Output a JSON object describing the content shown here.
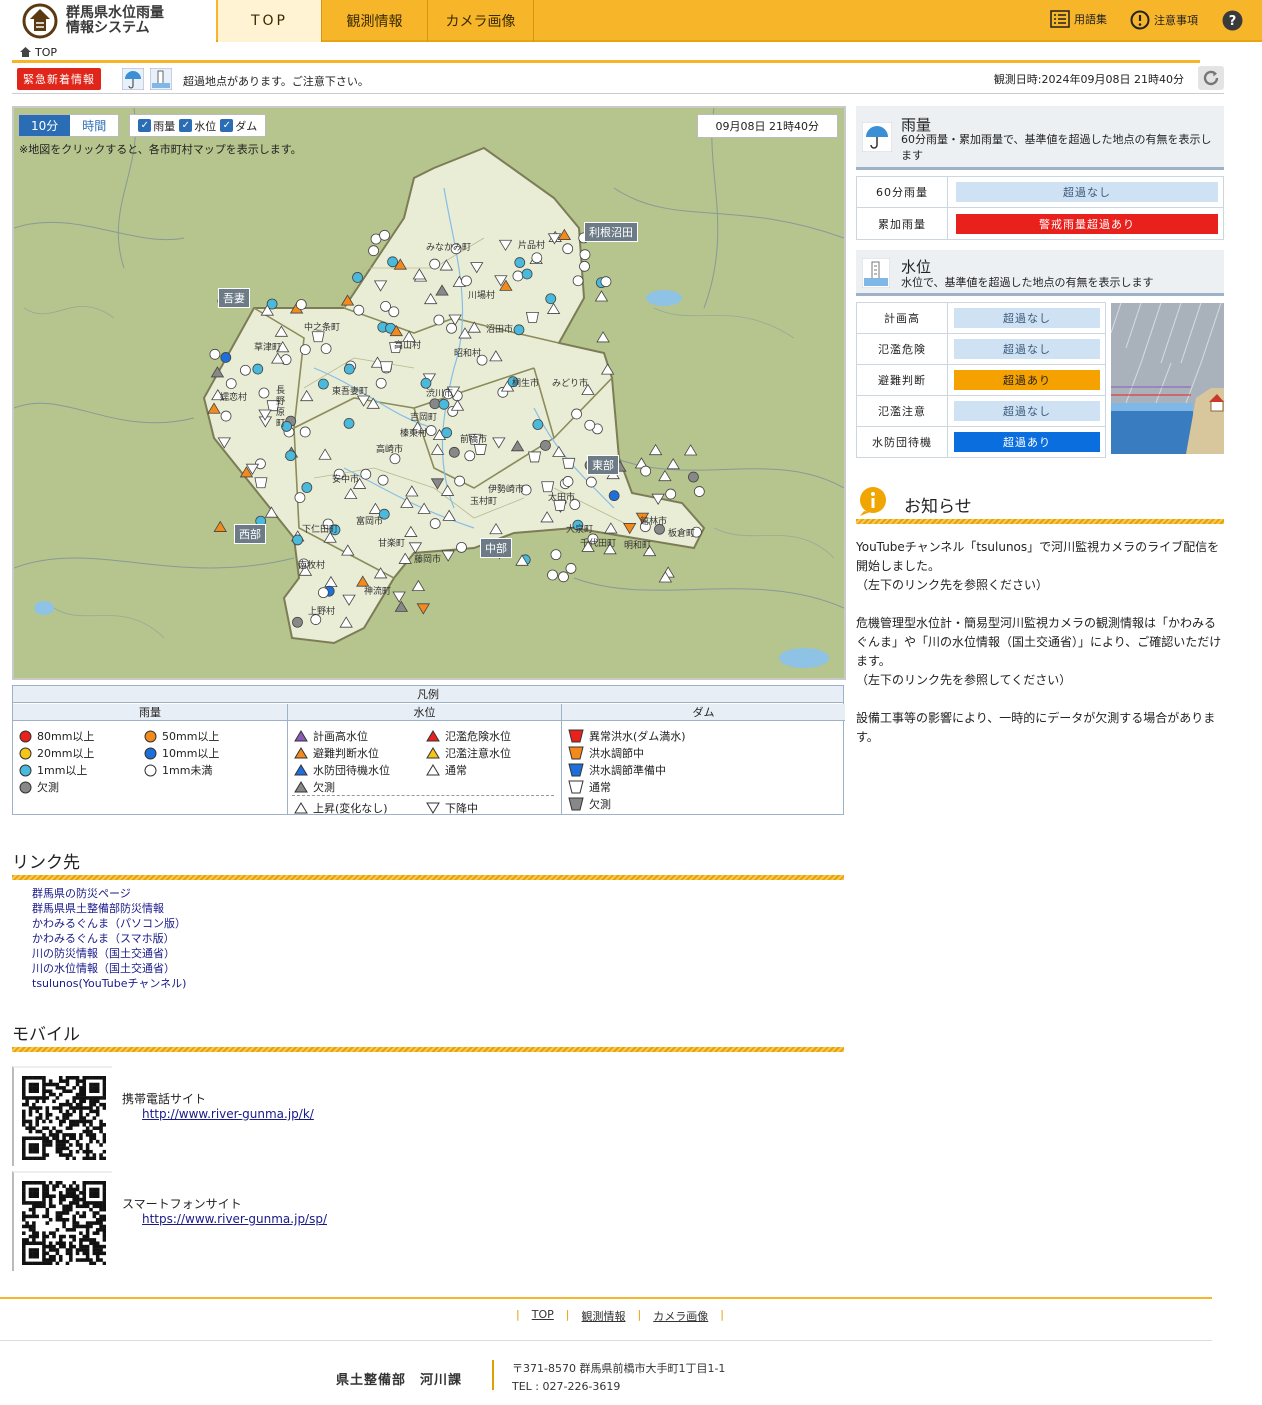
{
  "header": {
    "app_title_line1": "群馬県水位雨量",
    "app_title_line2": "情報システム",
    "nav": [
      "TOP",
      "観測情報",
      "カメラ画像"
    ],
    "glossary": "用語集",
    "notes": "注意事項",
    "help_icon": "question-icon"
  },
  "breadcrumb": "TOP",
  "alert": {
    "badge": "緊急新着情報",
    "message": "超過地点があります。ご注意下さい。",
    "observed": "観測日時:2024年09月08日 21時40分"
  },
  "map": {
    "seg_10min": "10分",
    "seg_hour": "時間",
    "chk_rain": "雨量",
    "chk_water": "水位",
    "chk_dam": "ダム",
    "datetime": "09月08日 21時40分",
    "note": "※地図をクリックすると、各市町村マップを表示します。",
    "regions": {
      "tone": "利根沼田",
      "agatsuma": "吾妻",
      "west": "西部",
      "central": "中部",
      "east": "東部"
    },
    "municipalities": [
      "みなかみ町",
      "片品村",
      "川場村",
      "沼田市",
      "中之条町",
      "高山村",
      "昭和村",
      "東吾妻町",
      "草津町",
      "長野原町",
      "嬬恋村",
      "渋川市",
      "吉岡町",
      "榛東村",
      "前橋市",
      "桐生市",
      "みどり市",
      "高崎市",
      "安中市",
      "伊勢崎市",
      "玉村町",
      "太田市",
      "大泉町",
      "千代田町",
      "明和町",
      "館林市",
      "板倉町",
      "富岡市",
      "下仁田町",
      "南牧村",
      "甘楽町",
      "藤岡市",
      "神流町",
      "上野村"
    ]
  },
  "legend": {
    "title": "凡例",
    "rain": {
      "title": "雨量",
      "items": [
        "80mm以上",
        "50mm以上",
        "20mm以上",
        "10mm以上",
        "1mm以上",
        "1mm未満",
        "欠測"
      ]
    },
    "water": {
      "title": "水位",
      "items": [
        "計画高水位",
        "氾濫危険水位",
        "避難判断水位",
        "氾濫注意水位",
        "水防団待機水位",
        "通常",
        "欠測",
        "上昇(変化なし)",
        "下降中"
      ]
    },
    "dam": {
      "title": "ダム",
      "items": [
        "異常洪水(ダム満水)",
        "洪水調節中",
        "洪水調節準備中",
        "通常",
        "欠測"
      ]
    }
  },
  "rain_panel": {
    "title": "雨量",
    "desc": "60分雨量・累加雨量で、基準値を超過した地点の有無を表示します",
    "rows": [
      {
        "label": "60分雨量",
        "status": "超過なし"
      },
      {
        "label": "累加雨量",
        "status": "警戒雨量超過あり"
      }
    ]
  },
  "water_panel": {
    "title": "水位",
    "desc": "水位で、基準値を超過した地点の有無を表示します",
    "rows": [
      {
        "label": "計画高",
        "status": "超過なし"
      },
      {
        "label": "氾濫危険",
        "status": "超過なし"
      },
      {
        "label": "避難判断",
        "status": "超過あり"
      },
      {
        "label": "氾濫注意",
        "status": "超過なし"
      },
      {
        "label": "水防団待機",
        "status": "超過あり"
      }
    ]
  },
  "news": {
    "title": "お知らせ",
    "body": "YouTubeチャンネル「tsulunos」で河川監視カメラのライブ配信を開始しました。\n（左下のリンク先を参照ください）\n\n危機管理型水位計・簡易型河川監視カメラの観測情報は「かわみるぐんま」や「川の水位情報（国土交通省）」により、ご確認いただけます。\n（左下のリンク先を参照してください）\n\n設備工事等の影響により、一時的にデータが欠測する場合があります。"
  },
  "links": {
    "title": "リンク先",
    "items": [
      "群馬県の防災ページ",
      "群馬県県土整備部防災情報",
      "かわみるぐんま（パソコン版）",
      "かわみるぐんま（スマホ版）",
      "川の防災情報（国土交通省）",
      "川の水位情報（国土交通省）",
      "tsulunos(YouTubeチャンネル)"
    ]
  },
  "mobile": {
    "title": "モバイル",
    "phone_label": "携帯電話サイト",
    "phone_url": "http://www.river-gunma.jp/k/",
    "smart_label": "スマートフォンサイト",
    "smart_url": "https://www.river-gunma.jp/sp/"
  },
  "footer": {
    "nav": [
      "TOP",
      "観測情報",
      "カメラ画像"
    ],
    "dept": "県土整備部　河川課",
    "address": "〒371-8570 群馬県前橋市大手町1丁目1-1",
    "tel": "TEL : 027-226-3619"
  },
  "colors": {
    "accent": "#f7b52a",
    "exceed_red": "#e8211c",
    "exceed_orange": "#f5a100",
    "exceed_blue": "#0a6ede",
    "none": "#cfe2f3"
  }
}
